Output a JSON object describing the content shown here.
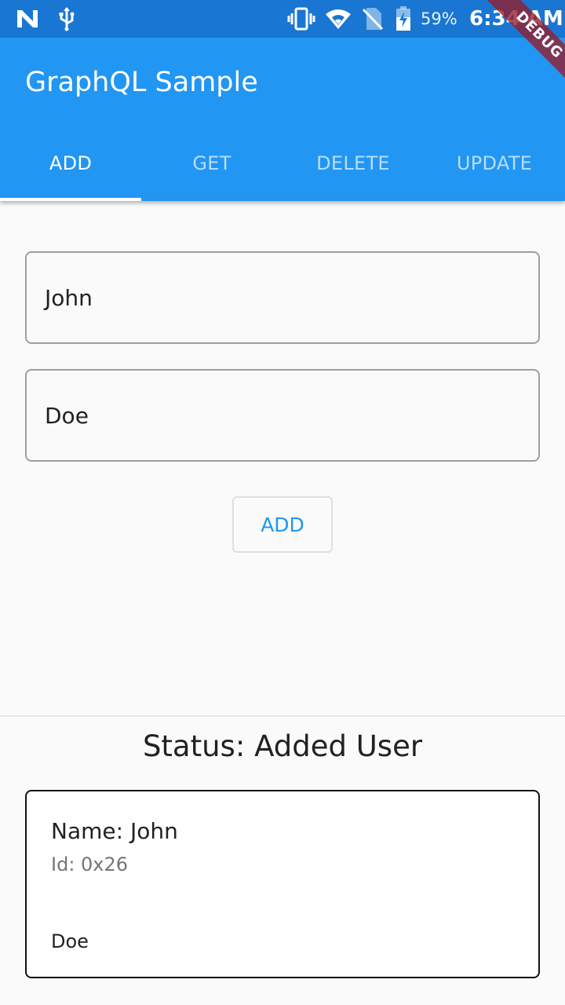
{
  "status_bar": {
    "battery_percent": "59%",
    "time": "6:34 AM",
    "icons": [
      "n-notification-icon",
      "usb-icon",
      "vibrate-icon",
      "wifi-icon",
      "no-sim-icon",
      "battery-charging-icon"
    ]
  },
  "debug_banner": "DEBUG",
  "app_bar": {
    "title": "GraphQL Sample",
    "tabs": [
      {
        "label": "ADD",
        "active": true
      },
      {
        "label": "GET",
        "active": false
      },
      {
        "label": "DELETE",
        "active": false
      },
      {
        "label": "UPDATE",
        "active": false
      }
    ]
  },
  "form": {
    "first_name_value": "John",
    "last_name_value": "Doe",
    "submit_label": "ADD"
  },
  "status": {
    "text": "Status: Added User"
  },
  "user_card": {
    "name_line": "Name: John",
    "id_line": "Id: 0x26",
    "last_name": "Doe"
  },
  "colors": {
    "primary": "#2196f3",
    "primary_dark": "#1976d2",
    "background": "#fafafa"
  }
}
